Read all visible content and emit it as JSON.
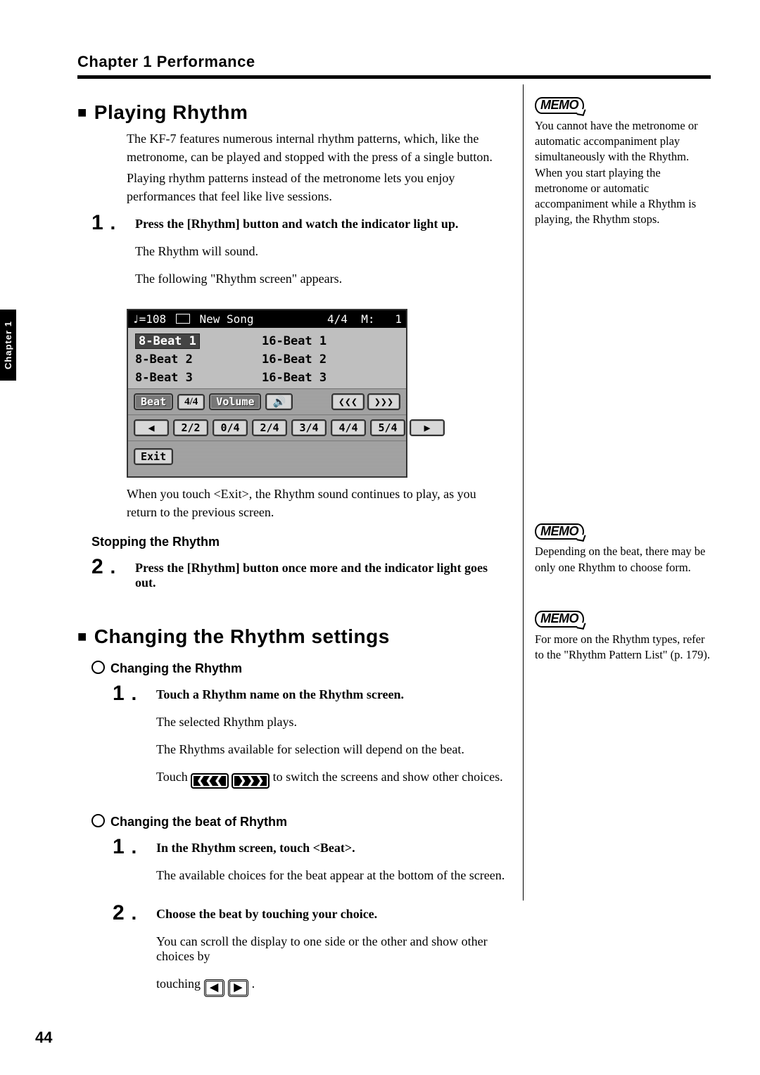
{
  "header": {
    "chapter": "Chapter 1 Performance"
  },
  "side_tab": "Chapter 1",
  "page_number": "44",
  "s1": {
    "title": "Playing Rhythm",
    "p1": "The KF-7 features numerous internal rhythm patterns, which, like the metronome, can be played and stopped with the press of a single button.",
    "p2": "Playing rhythm patterns instead of the metronome lets you enjoy performances that feel like live sessions.",
    "step1": {
      "num": "1",
      "bold": "Press the [Rhythm] button and watch the indicator light up.",
      "a": "The Rhythm will sound.",
      "b": "The following \"Rhythm screen\" appears."
    },
    "after_shot": "When you touch <Exit>, the Rhythm sound continues to play, as you return to the previous screen.",
    "sub_heading": "Stopping the Rhythm",
    "step2": {
      "num": "2",
      "bold": "Press the [Rhythm] button once more and the indicator light goes out."
    }
  },
  "lcd": {
    "tempo": "♩=108",
    "title": "New Song",
    "ts": "4/4",
    "meas_lbl": "M:",
    "meas": "1",
    "rows": [
      {
        "l": "8-Beat 1",
        "r": "16-Beat 1"
      },
      {
        "l": "8-Beat 2",
        "r": "16-Beat 2"
      },
      {
        "l": "8-Beat 3",
        "r": "16-Beat 3"
      }
    ],
    "beat_btn": "Beat",
    "beat_val": "4/4",
    "vol_btn": "Volume",
    "prev": "❮❮❮",
    "next": "❯❯❯",
    "beats": [
      "2/2",
      "0/4",
      "2/4",
      "3/4",
      "4/4",
      "5/4"
    ],
    "left": "◀",
    "right": "▶",
    "exit": "Exit"
  },
  "s2": {
    "title": "Changing the Rhythm settings",
    "sub1": "Changing the Rhythm",
    "s1_step1": {
      "num": "1",
      "bold": "Touch a Rhythm name on the Rhythm screen.",
      "a": "The selected Rhythm plays.",
      "b": "The Rhythms available for selection will depend on the beat.",
      "c_pre": "Touch ",
      "c_post": " to switch the screens and show other choices."
    },
    "sub2": "Changing the beat of Rhythm",
    "s2_step1": {
      "num": "1",
      "bold": "In the Rhythm screen, touch <Beat>.",
      "a": "The available choices for the beat appear at the bottom of the screen."
    },
    "s2_step2": {
      "num": "2",
      "bold": "Choose the beat by touching your choice.",
      "a": "You can scroll the display to one side or the other and show other choices by",
      "b_pre": "touching ",
      "b_post": "."
    }
  },
  "memos": {
    "label": "MEMO",
    "m1": "You cannot have the metronome or automatic accompaniment play simultaneously with the Rhythm. When you start playing the metronome or automatic accompaniment while a Rhythm is playing, the Rhythm stops.",
    "m2": "Depending on the beat, there may be only one Rhythm to choose form.",
    "m3": "For more on the Rhythm types, refer to the \"Rhythm Pattern List\" (p. 179)."
  }
}
